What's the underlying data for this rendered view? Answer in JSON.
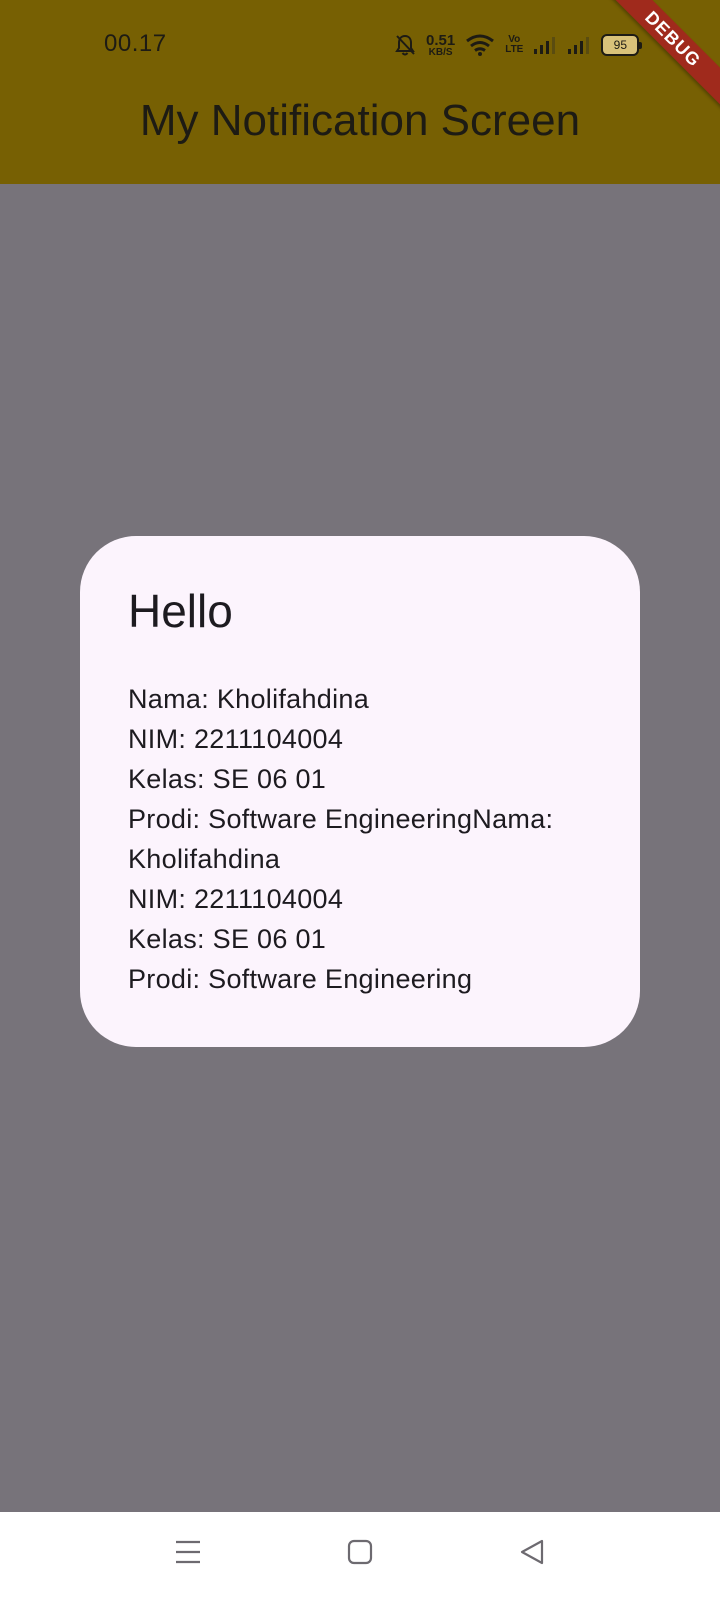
{
  "status_bar": {
    "time": "00.17",
    "net_speed_value": "0.51",
    "net_speed_unit": "KB/S",
    "volte_top": "Vo",
    "volte_bottom": "LTE",
    "battery_level": "95",
    "icons": [
      "bell-off-icon",
      "wifi-icon",
      "volte-icon",
      "signal-icon",
      "signal-icon",
      "battery-icon"
    ]
  },
  "appbar": {
    "title": "My Notification Screen",
    "background_color": "#776003"
  },
  "debug_banner": {
    "label": "DEBUG",
    "color": "#a02a1c"
  },
  "dialog": {
    "title": "Hello",
    "content": "Nama: Kholifahdina\nNIM: 2211104004\nKelas: SE 06 01\nProdi: Software EngineeringNama: Kholifahdina\nNIM: 2211104004\nKelas: SE 06 01\nProdi: Software Engineering",
    "background_color": "#fcf4fd"
  },
  "scrim_color": "#77737a",
  "nav_bar": {
    "icons": [
      "menu-icon",
      "home-icon",
      "back-icon"
    ]
  }
}
